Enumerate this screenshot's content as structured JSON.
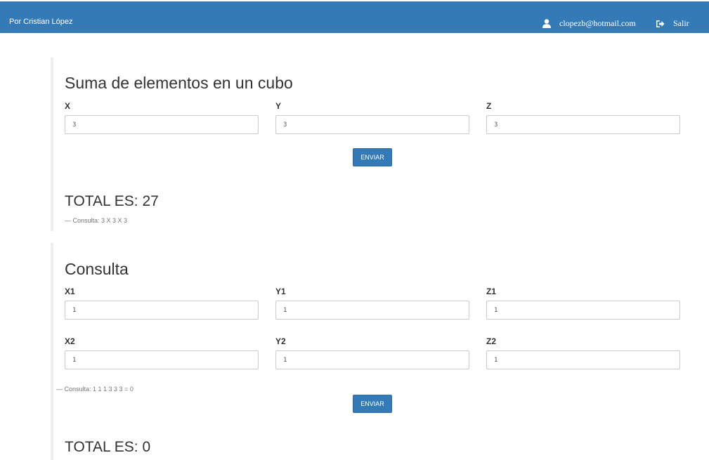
{
  "nav": {
    "brand": "Por Cristian López",
    "email": "clopezb@hotmail.com",
    "logout": "Salir",
    "user_icon": "user-icon",
    "logout_icon": "log-out-icon"
  },
  "suma": {
    "title": "Suma de elementos en un cubo",
    "labels": {
      "x": "X",
      "y": "Y",
      "z": "Z"
    },
    "values": {
      "x": "3",
      "y": "3",
      "z": "3"
    },
    "submit": "ENVIAR",
    "total": "TOTAL ES: 27",
    "footer": "— Consulta: 3 X 3 X 3"
  },
  "consulta": {
    "title": "Consulta",
    "labels": {
      "x1": "X1",
      "y1": "Y1",
      "z1": "Z1",
      "x2": "X2",
      "y2": "Y2",
      "z2": "Z2"
    },
    "values": {
      "x1": "1",
      "y1": "1",
      "z1": "1",
      "x2": "1",
      "y2": "1",
      "z2": "1"
    },
    "footer": "— Consulta: 1 1 1 3 3 3 = 0",
    "submit": "ENVIAR",
    "total": "TOTAL ES: 0"
  },
  "colors": {
    "primary": "#337ab7",
    "panel_border": "#eeeeee"
  }
}
